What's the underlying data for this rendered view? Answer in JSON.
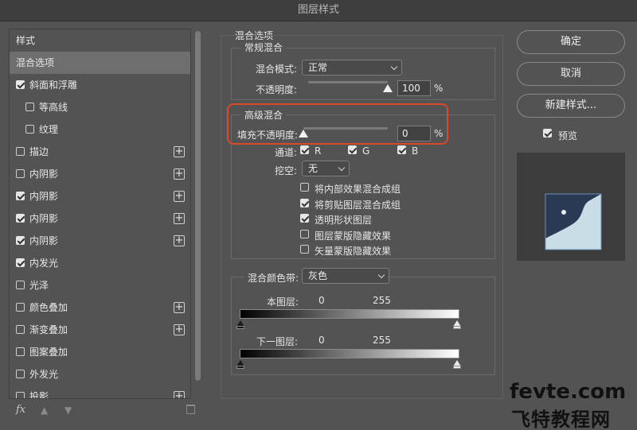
{
  "window": {
    "title": "图层样式"
  },
  "styles_list": {
    "header": "样式",
    "items": [
      {
        "label": "混合选项",
        "checkbox": null,
        "checked": false,
        "selected": true,
        "sub": false,
        "plus": false
      },
      {
        "label": "斜面和浮雕",
        "checkbox": true,
        "checked": true,
        "selected": false,
        "sub": false,
        "plus": false
      },
      {
        "label": "等高线",
        "checkbox": true,
        "checked": false,
        "selected": false,
        "sub": true,
        "plus": false
      },
      {
        "label": "纹理",
        "checkbox": true,
        "checked": false,
        "selected": false,
        "sub": true,
        "plus": false
      },
      {
        "label": "描边",
        "checkbox": true,
        "checked": false,
        "selected": false,
        "sub": false,
        "plus": true
      },
      {
        "label": "内阴影",
        "checkbox": true,
        "checked": false,
        "selected": false,
        "sub": false,
        "plus": true
      },
      {
        "label": "内阴影",
        "checkbox": true,
        "checked": true,
        "selected": false,
        "sub": false,
        "plus": true
      },
      {
        "label": "内阴影",
        "checkbox": true,
        "checked": true,
        "selected": false,
        "sub": false,
        "plus": true
      },
      {
        "label": "内阴影",
        "checkbox": true,
        "checked": true,
        "selected": false,
        "sub": false,
        "plus": true
      },
      {
        "label": "内发光",
        "checkbox": true,
        "checked": true,
        "selected": false,
        "sub": false,
        "plus": false
      },
      {
        "label": "光泽",
        "checkbox": true,
        "checked": false,
        "selected": false,
        "sub": false,
        "plus": false
      },
      {
        "label": "颜色叠加",
        "checkbox": true,
        "checked": false,
        "selected": false,
        "sub": false,
        "plus": true
      },
      {
        "label": "渐变叠加",
        "checkbox": true,
        "checked": false,
        "selected": false,
        "sub": false,
        "plus": true
      },
      {
        "label": "图案叠加",
        "checkbox": true,
        "checked": false,
        "selected": false,
        "sub": false,
        "plus": false
      },
      {
        "label": "外发光",
        "checkbox": true,
        "checked": false,
        "selected": false,
        "sub": false,
        "plus": false
      },
      {
        "label": "投影",
        "checkbox": true,
        "checked": false,
        "selected": false,
        "sub": false,
        "plus": true
      }
    ],
    "footer": {
      "fx_label": "fx",
      "up_icon": "arrow-up-icon",
      "down_icon": "arrow-down-icon",
      "delete_icon": "trash-icon"
    }
  },
  "blend_options": {
    "section_title": "混合选项",
    "general": {
      "title": "常规混合",
      "mode_label": "混合模式:",
      "mode_value": "正常",
      "opacity_label": "不透明度:",
      "opacity_value": "100",
      "opacity_fraction": 1.0,
      "unit": "%"
    },
    "advanced": {
      "title": "高级混合",
      "fill_label": "填充不透明度:",
      "fill_value": "0",
      "fill_fraction": 0.0,
      "unit": "%",
      "channels_label": "通道:",
      "channel_r": "R",
      "channel_g": "G",
      "channel_b": "B",
      "knockout_label": "挖空:",
      "knockout_value": "无",
      "options": [
        {
          "label": "将内部效果混合成组",
          "checked": false
        },
        {
          "label": "将剪贴图层混合成组",
          "checked": true
        },
        {
          "label": "透明形状图层",
          "checked": true
        },
        {
          "label": "图层蒙版隐藏效果",
          "checked": false
        },
        {
          "label": "矢量蒙版隐藏效果",
          "checked": false
        }
      ]
    },
    "blend_if": {
      "label": "混合颜色带:",
      "value": "灰色",
      "this_layer_label": "本图层:",
      "this_layer_low": "0",
      "this_layer_high": "255",
      "underlying_label": "下一图层:",
      "underlying_low": "0",
      "underlying_high": "255"
    }
  },
  "actions": {
    "ok": "确定",
    "cancel": "取消",
    "new_style": "新建样式...",
    "preview_label": "预览",
    "preview_checked": true
  },
  "watermark": {
    "line1": "fevte.com",
    "line2": "飞特教程网"
  },
  "colors": {
    "accent_red": "#d9492a",
    "panel_bg": "#535353"
  }
}
